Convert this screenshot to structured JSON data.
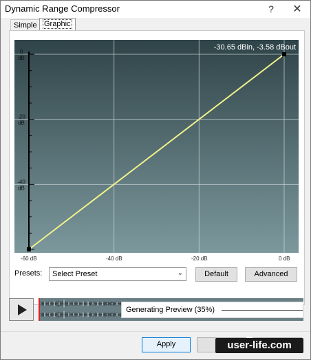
{
  "window": {
    "title": "Dynamic Range Compressor",
    "help_glyph": "?",
    "close_glyph": "✕"
  },
  "tabs": [
    {
      "label": "Simple"
    },
    {
      "label": "Graphic"
    }
  ],
  "chart_data": {
    "type": "line",
    "readout": "-30.65 dBin, -3.58 dBout",
    "x_ticks": [
      "-60 dB",
      "-40 dB",
      "-20 dB",
      "0 dB"
    ],
    "y_ticks": [
      {
        "value": "0",
        "unit": "dB"
      },
      {
        "value": "-20",
        "unit": "dB"
      },
      {
        "value": "-40",
        "unit": "dB"
      }
    ],
    "xlim": [
      -60,
      0
    ],
    "ylim": [
      -60,
      0
    ],
    "series": [
      {
        "x": [
          -60,
          0
        ],
        "y": [
          -60,
          0
        ]
      }
    ],
    "control_points": [
      {
        "x": -60,
        "y": -60
      },
      {
        "x": 0,
        "y": 0
      }
    ],
    "grid": true,
    "colors": {
      "curve": "#f2f28a",
      "bg_top": "#2f4448",
      "bg_bottom": "#7c989d",
      "grid": "#cfd8da",
      "point": "#000000"
    }
  },
  "presets": {
    "label": "Presets:",
    "selected": "Select Preset",
    "default_button": "Default",
    "advanced_button": "Advanced"
  },
  "preview": {
    "status": "Generating Preview (35%)",
    "progress": 0.35
  },
  "footer": {
    "apply_button": "Apply"
  },
  "watermark": "user-life.com"
}
